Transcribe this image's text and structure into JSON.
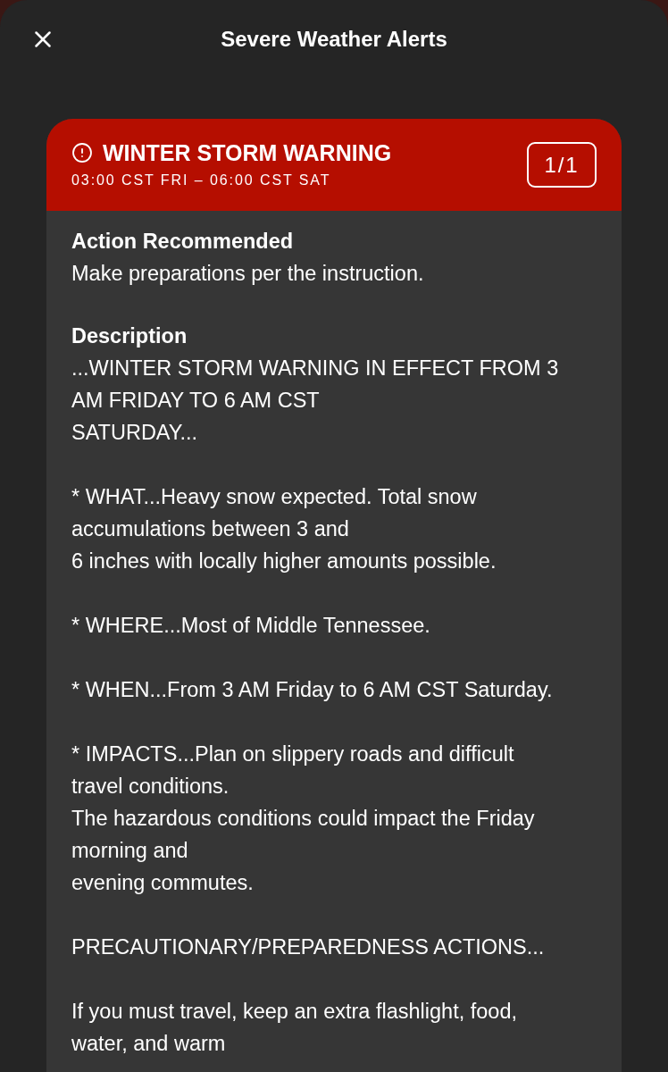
{
  "header": {
    "title": "Severe Weather Alerts"
  },
  "alert": {
    "title": "WINTER STORM WARNING",
    "time_range": "03:00 CST FRI – 06:00 CST SAT",
    "counter": "1/1"
  },
  "sections": [
    {
      "heading": "Action Recommended",
      "paragraphs": [
        "Make preparations per the instruction."
      ]
    },
    {
      "heading": "Description",
      "paragraphs": [
        "...WINTER STORM WARNING IN EFFECT FROM 3\nAM FRIDAY TO 6 AM CST\nSATURDAY...",
        "* WHAT...Heavy snow expected. Total snow\naccumulations between 3 and\n6 inches with locally higher amounts possible.",
        "* WHERE...Most of Middle Tennessee.",
        "* WHEN...From 3 AM Friday to 6 AM CST Saturday.",
        "* IMPACTS...Plan on slippery roads and difficult\ntravel conditions.\nThe hazardous conditions could impact the Friday\nmorning and\nevening commutes.",
        "PRECAUTIONARY/PREPAREDNESS ACTIONS...",
        "If you must travel, keep an extra flashlight, food,\nwater, and warm"
      ]
    }
  ]
}
